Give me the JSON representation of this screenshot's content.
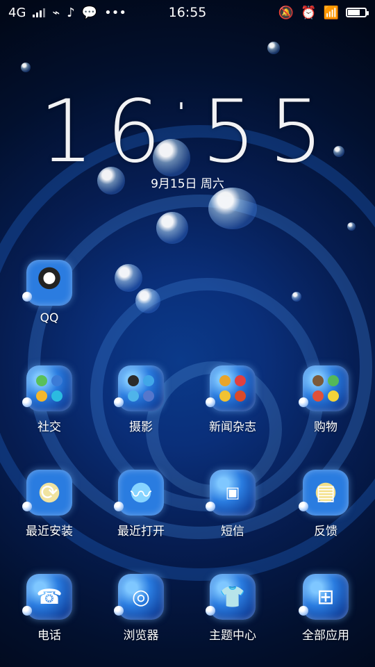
{
  "status_bar": {
    "network_type": "4G",
    "time": "16:55",
    "battery_level": 0.7,
    "icons_left": [
      "signal-icon",
      "usb-icon",
      "voice-icon",
      "wechat-icon",
      "more-icon"
    ],
    "icons_right": [
      "mute-bell-icon",
      "alarm-icon",
      "wifi-icon",
      "battery-icon"
    ]
  },
  "lock_clock": {
    "hours": "16",
    "minutes": "55",
    "date": "9月15日 周六"
  },
  "apps": [
    {
      "label": "QQ",
      "icon": "qq-icon"
    },
    {
      "label": "社交",
      "icon": "social-folder-icon"
    },
    {
      "label": "摄影",
      "icon": "camera-folder-icon"
    },
    {
      "label": "新闻杂志",
      "icon": "news-folder-icon"
    },
    {
      "label": "购物",
      "icon": "shopping-folder-icon"
    },
    {
      "label": "最近安装",
      "icon": "recent-installs-icon"
    },
    {
      "label": "最近打开",
      "icon": "recent-opened-icon"
    },
    {
      "label": "短信",
      "icon": "messages-icon"
    },
    {
      "label": "反馈",
      "icon": "feedback-icon"
    },
    {
      "label": "电话",
      "icon": "phone-icon"
    },
    {
      "label": "浏览器",
      "icon": "browser-icon"
    },
    {
      "label": "主题中心",
      "icon": "theme-center-icon"
    },
    {
      "label": "全部应用",
      "icon": "all-apps-icon"
    }
  ]
}
